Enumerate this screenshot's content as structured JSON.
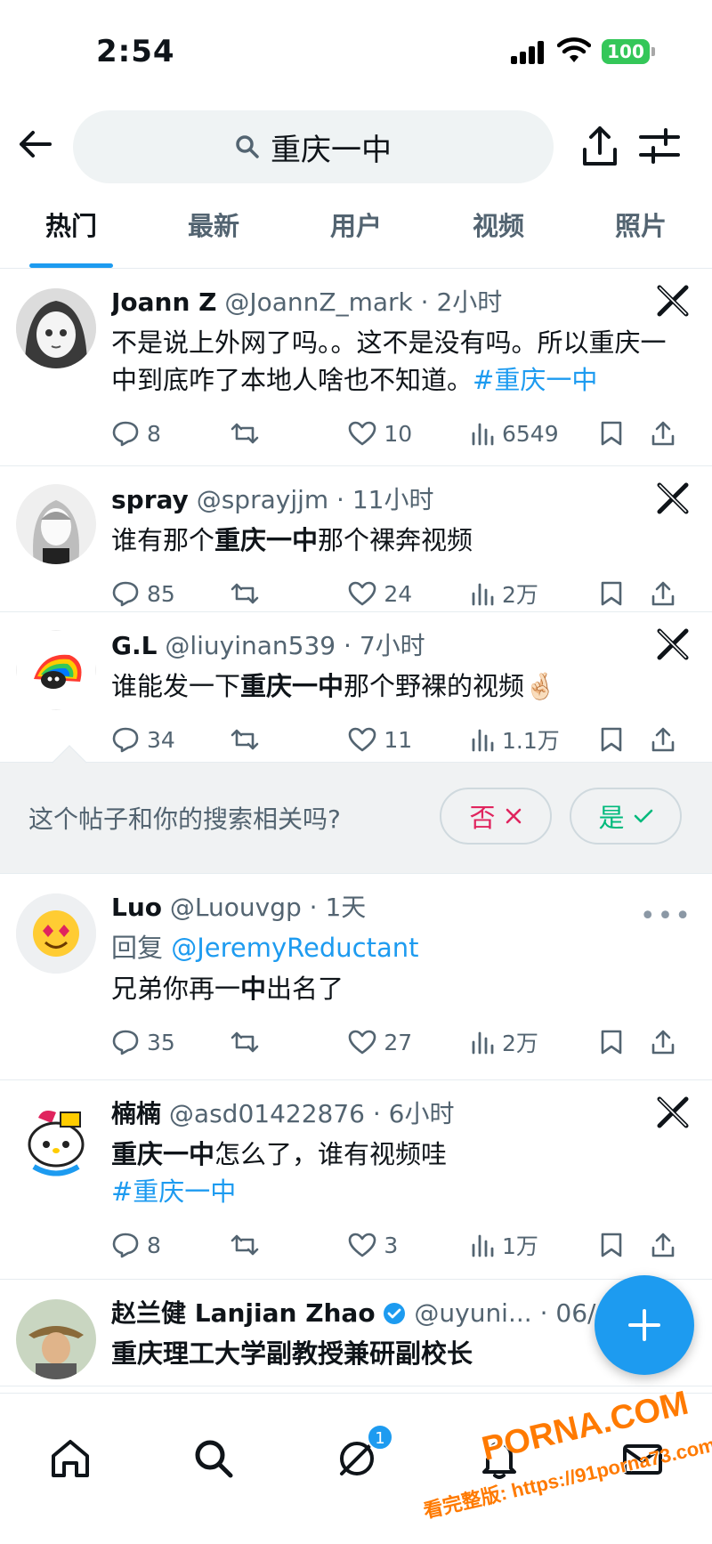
{
  "status_bar": {
    "time": "2:54",
    "battery": "100",
    "battery_color": "#34c759"
  },
  "header": {
    "back_icon": "arrow-left-icon",
    "search_query": "重庆一中",
    "share_icon": "share-icon",
    "filter_icon": "filter-sliders-icon"
  },
  "tabs": [
    {
      "label": "热门",
      "active": true
    },
    {
      "label": "最新",
      "active": false
    },
    {
      "label": "用户",
      "active": false
    },
    {
      "label": "视频",
      "active": false
    },
    {
      "label": "照片",
      "active": false
    }
  ],
  "posts": [
    {
      "name": "Joann Z",
      "handle": "@JoannZ_mark",
      "time": "2小时",
      "text": "不是说上外网了吗。。这不是没有吗。所以重庆一中到底咋了本地人啥也不知道。",
      "hashtag": "#重庆一中",
      "replies": "8",
      "retweets": "",
      "likes": "10",
      "views": "6549"
    },
    {
      "name": "spray",
      "handle": "@sprayjjm",
      "time": "11小时",
      "text_before": "谁有那个",
      "text_bold": "重庆一中",
      "text_after": "那个裸奔视频",
      "replies": "85",
      "retweets": "",
      "likes": "24",
      "views": "2万"
    },
    {
      "name": "G.L",
      "handle": "@liuyinan539",
      "time": "7小时",
      "text_before": "谁能发一下",
      "text_bold": "重庆一中",
      "text_after": "那个野裸的视频",
      "emoji": "🤞🏻",
      "replies": "34",
      "retweets": "",
      "likes": "11",
      "views": "1.1万"
    },
    {
      "name": "Luo",
      "handle": "@Luouvgp",
      "time": "1天",
      "reply_prefix": "回复",
      "reply_to": "@JeremyReductant",
      "text_before": "兄弟你再一",
      "text_bold": "中",
      "text_after": "出名了",
      "emoji": "😍",
      "replies": "35",
      "retweets": "",
      "likes": "27",
      "views": "2万"
    },
    {
      "name": "楠楠",
      "handle": "@asd01422876",
      "time": "6小时",
      "text_bold": "重庆一中",
      "text_after": "怎么了，谁有视频哇",
      "hashtag": "#重庆一中",
      "replies": "8",
      "retweets": "",
      "likes": "3",
      "views": "1万"
    },
    {
      "name": "赵兰健 Lanjian Zhao",
      "handle": "@uyuni...",
      "time": "06/06",
      "text": "重庆理工大学副教授兼研副校长"
    }
  ],
  "relevance": {
    "question": "这个帖子和你的搜索相关吗?",
    "no_label": "否",
    "yes_label": "是"
  },
  "bottom_nav": {
    "home_icon": "home-icon",
    "search_icon": "search-icon",
    "grok_icon": "grok-icon",
    "grok_badge": "1",
    "notifications_icon": "bell-icon",
    "messages_icon": "mail-icon"
  },
  "watermark": {
    "main": "PORNA.COM",
    "sub": "看完整版: https://91porna73.com"
  },
  "colors": {
    "accent": "#1d9bf0",
    "muted": "#536471",
    "no": "#e0245e",
    "yes": "#00ba7c"
  }
}
